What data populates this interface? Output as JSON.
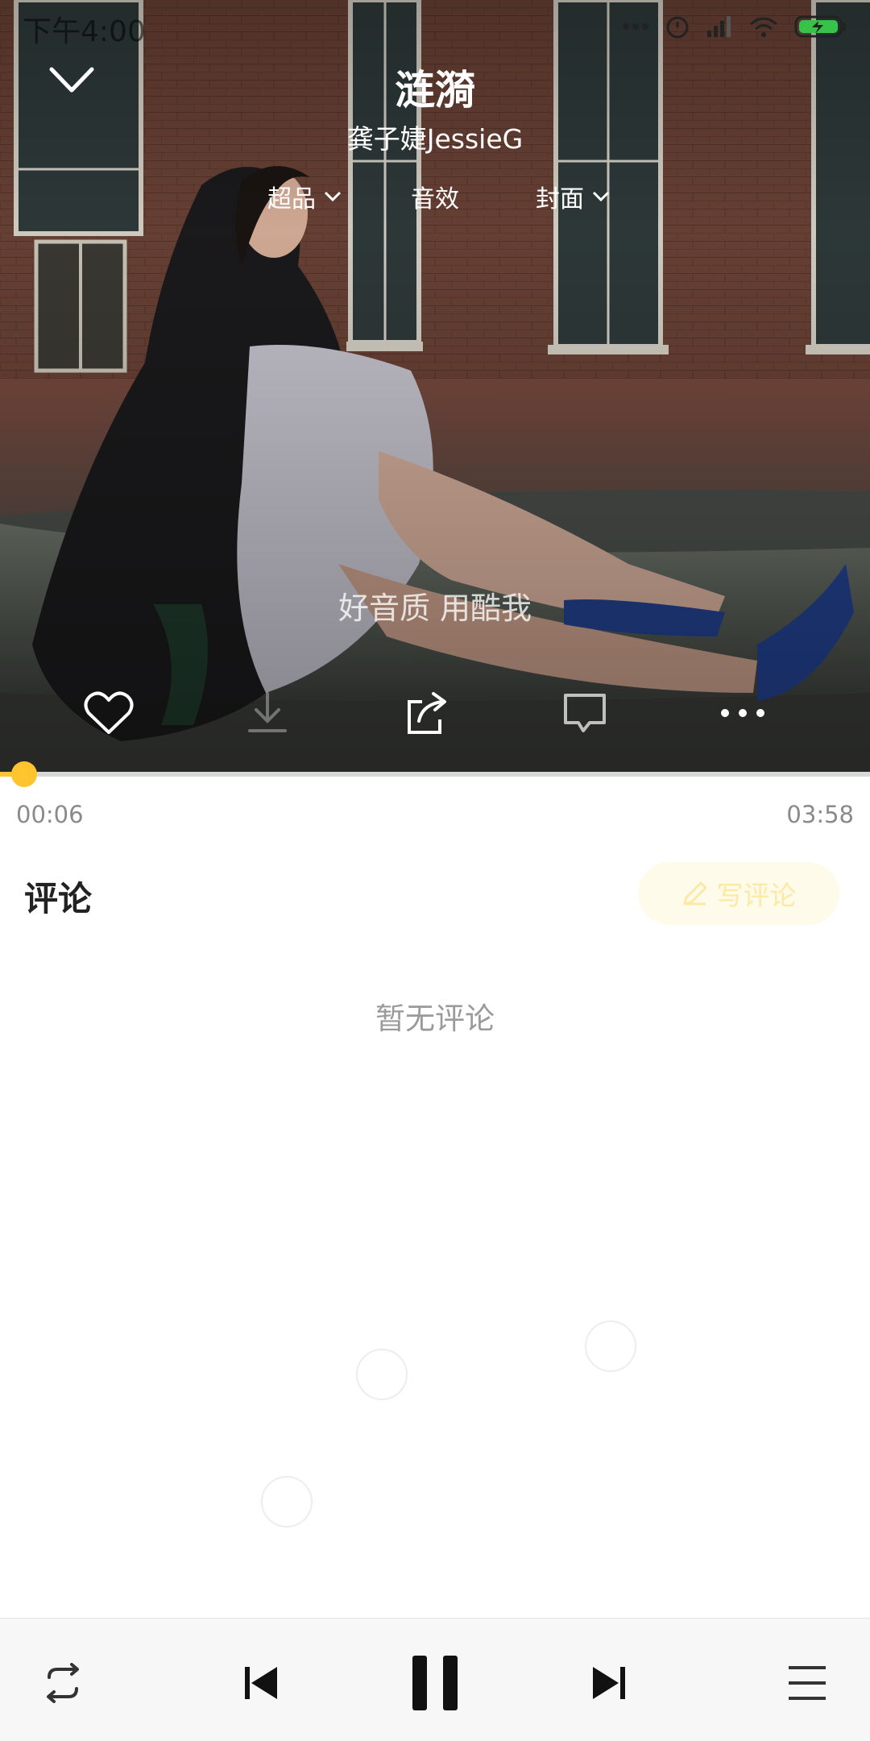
{
  "status_bar": {
    "time": "下午4:00"
  },
  "header": {
    "title": "涟漪",
    "artist": "龚子婕JessieG",
    "options": [
      {
        "label": "超品",
        "has_dropdown": true
      },
      {
        "label": "音效",
        "has_dropdown": false
      },
      {
        "label": "封面",
        "has_dropdown": true
      }
    ]
  },
  "cover": {
    "ad_text": "好音质 用酷我"
  },
  "actions": [
    "heart-icon",
    "download-icon",
    "share-icon",
    "comment-icon",
    "more-icon"
  ],
  "progress": {
    "elapsed": "00:06",
    "total": "03:58",
    "fraction": 0.025
  },
  "comments": {
    "title": "评论",
    "write_label": "写评论",
    "empty_text": "暂无评论"
  },
  "player": {
    "buttons": [
      "repeat-icon",
      "previous-icon",
      "pause-icon",
      "next-icon",
      "playlist-icon"
    ]
  },
  "colors": {
    "accent": "#ffc42e",
    "background": "#ffffff"
  }
}
